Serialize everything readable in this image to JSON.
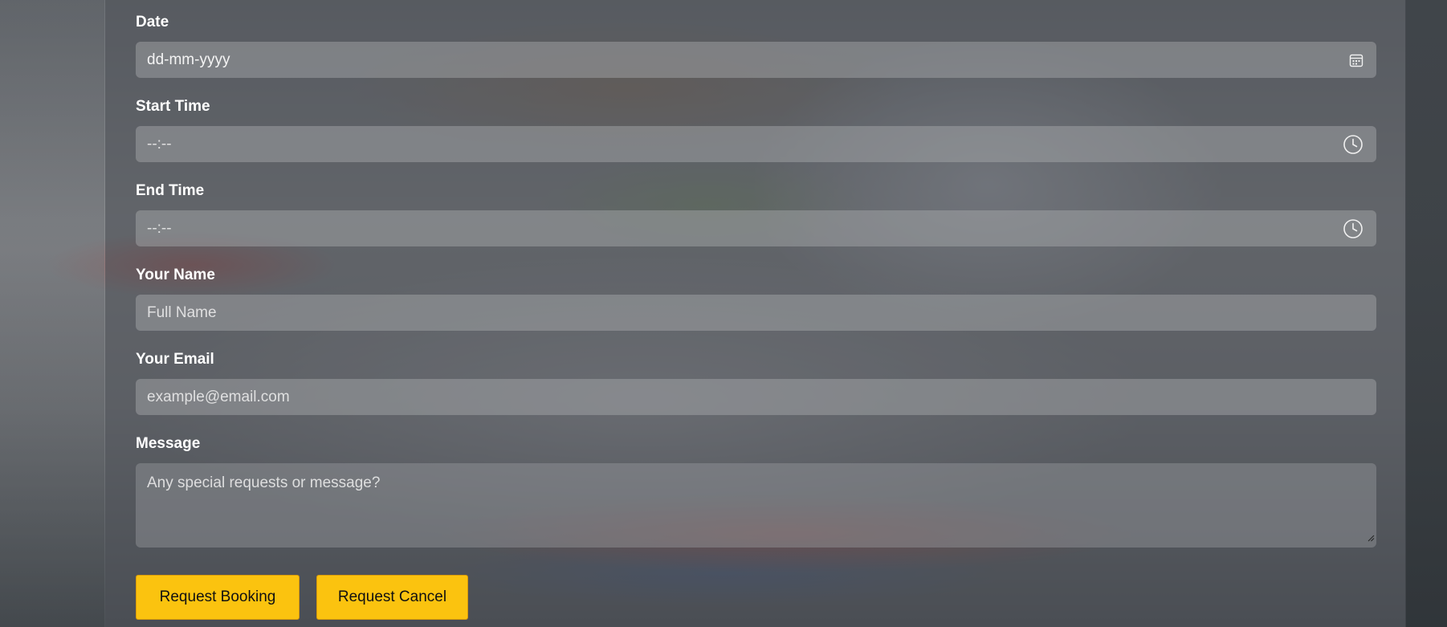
{
  "form": {
    "date": {
      "label": "Date",
      "placeholder": "dd-mm-yyyy",
      "icon": "calendar-icon"
    },
    "start_time": {
      "label": "Start Time",
      "placeholder": "--:--",
      "icon": "clock-icon"
    },
    "end_time": {
      "label": "End Time",
      "placeholder": "--:--",
      "icon": "clock-icon"
    },
    "name": {
      "label": "Your Name",
      "placeholder": "Full Name"
    },
    "email": {
      "label": "Your Email",
      "placeholder": "example@email.com"
    },
    "message": {
      "label": "Message",
      "placeholder": "Any special requests or message?"
    }
  },
  "buttons": {
    "request_booking": "Request Booking",
    "request_cancel": "Request Cancel"
  },
  "colors": {
    "button_bg": "#fbc30f",
    "label_text": "#ffffff"
  }
}
